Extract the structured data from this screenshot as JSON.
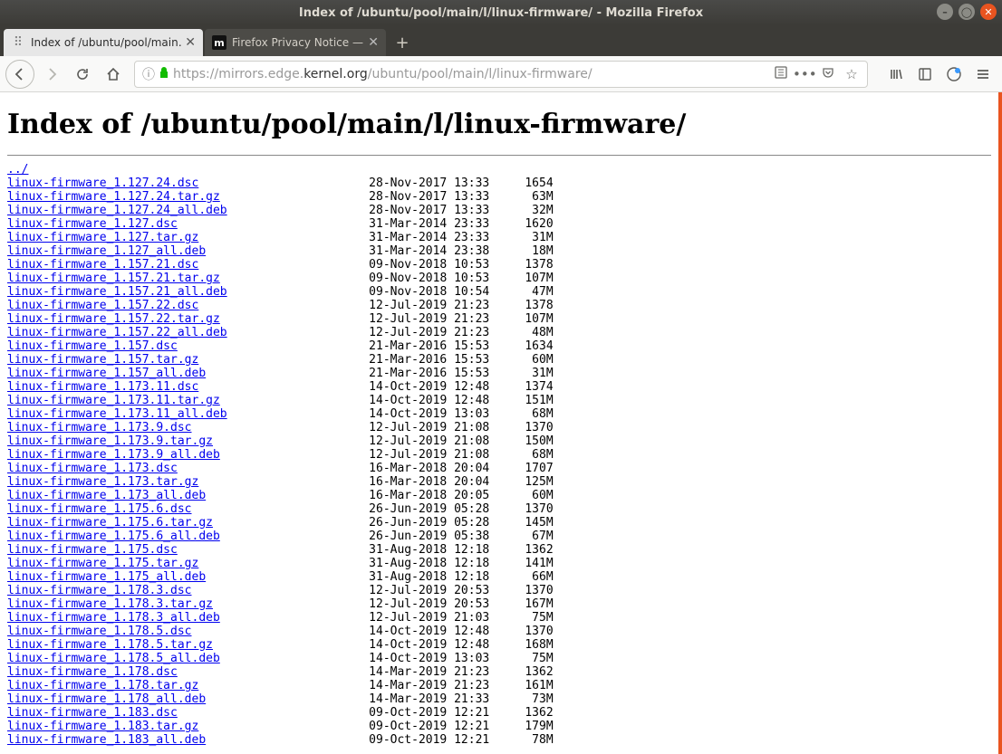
{
  "window": {
    "title": "Index of /ubuntu/pool/main/l/linux-firmware/ - Mozilla Firefox"
  },
  "tabs": [
    {
      "label": "Index of /ubuntu/pool/main…",
      "favicon": "dots",
      "active": true
    },
    {
      "label": "Firefox Privacy Notice —",
      "favicon": "moz",
      "active": false
    }
  ],
  "url": {
    "scheme": "https://",
    "sub": "mirrors.edge.",
    "host": "kernel.org",
    "path": "/ubuntu/pool/main/l/linux-firmware/"
  },
  "page": {
    "heading": "Index of /ubuntu/pool/main/l/linux-firmware/",
    "parent": "../",
    "files": [
      {
        "name": "linux-firmware_1.127.24.dsc",
        "date": "28-Nov-2017 13:33",
        "size": "1654"
      },
      {
        "name": "linux-firmware_1.127.24.tar.gz",
        "date": "28-Nov-2017 13:33",
        "size": "63M"
      },
      {
        "name": "linux-firmware_1.127.24_all.deb",
        "date": "28-Nov-2017 13:33",
        "size": "32M"
      },
      {
        "name": "linux-firmware_1.127.dsc",
        "date": "31-Mar-2014 23:33",
        "size": "1620"
      },
      {
        "name": "linux-firmware_1.127.tar.gz",
        "date": "31-Mar-2014 23:33",
        "size": "31M"
      },
      {
        "name": "linux-firmware_1.127_all.deb",
        "date": "31-Mar-2014 23:38",
        "size": "18M"
      },
      {
        "name": "linux-firmware_1.157.21.dsc",
        "date": "09-Nov-2018 10:53",
        "size": "1378"
      },
      {
        "name": "linux-firmware_1.157.21.tar.gz",
        "date": "09-Nov-2018 10:53",
        "size": "107M"
      },
      {
        "name": "linux-firmware_1.157.21_all.deb",
        "date": "09-Nov-2018 10:54",
        "size": "47M"
      },
      {
        "name": "linux-firmware_1.157.22.dsc",
        "date": "12-Jul-2019 21:23",
        "size": "1378"
      },
      {
        "name": "linux-firmware_1.157.22.tar.gz",
        "date": "12-Jul-2019 21:23",
        "size": "107M"
      },
      {
        "name": "linux-firmware_1.157.22_all.deb",
        "date": "12-Jul-2019 21:23",
        "size": "48M"
      },
      {
        "name": "linux-firmware_1.157.dsc",
        "date": "21-Mar-2016 15:53",
        "size": "1634"
      },
      {
        "name": "linux-firmware_1.157.tar.gz",
        "date": "21-Mar-2016 15:53",
        "size": "60M"
      },
      {
        "name": "linux-firmware_1.157_all.deb",
        "date": "21-Mar-2016 15:53",
        "size": "31M"
      },
      {
        "name": "linux-firmware_1.173.11.dsc",
        "date": "14-Oct-2019 12:48",
        "size": "1374"
      },
      {
        "name": "linux-firmware_1.173.11.tar.gz",
        "date": "14-Oct-2019 12:48",
        "size": "151M"
      },
      {
        "name": "linux-firmware_1.173.11_all.deb",
        "date": "14-Oct-2019 13:03",
        "size": "68M"
      },
      {
        "name": "linux-firmware_1.173.9.dsc",
        "date": "12-Jul-2019 21:08",
        "size": "1370"
      },
      {
        "name": "linux-firmware_1.173.9.tar.gz",
        "date": "12-Jul-2019 21:08",
        "size": "150M"
      },
      {
        "name": "linux-firmware_1.173.9_all.deb",
        "date": "12-Jul-2019 21:08",
        "size": "68M"
      },
      {
        "name": "linux-firmware_1.173.dsc",
        "date": "16-Mar-2018 20:04",
        "size": "1707"
      },
      {
        "name": "linux-firmware_1.173.tar.gz",
        "date": "16-Mar-2018 20:04",
        "size": "125M"
      },
      {
        "name": "linux-firmware_1.173_all.deb",
        "date": "16-Mar-2018 20:05",
        "size": "60M"
      },
      {
        "name": "linux-firmware_1.175.6.dsc",
        "date": "26-Jun-2019 05:28",
        "size": "1370"
      },
      {
        "name": "linux-firmware_1.175.6.tar.gz",
        "date": "26-Jun-2019 05:28",
        "size": "145M"
      },
      {
        "name": "linux-firmware_1.175.6_all.deb",
        "date": "26-Jun-2019 05:38",
        "size": "67M"
      },
      {
        "name": "linux-firmware_1.175.dsc",
        "date": "31-Aug-2018 12:18",
        "size": "1362"
      },
      {
        "name": "linux-firmware_1.175.tar.gz",
        "date": "31-Aug-2018 12:18",
        "size": "141M"
      },
      {
        "name": "linux-firmware_1.175_all.deb",
        "date": "31-Aug-2018 12:18",
        "size": "66M"
      },
      {
        "name": "linux-firmware_1.178.3.dsc",
        "date": "12-Jul-2019 20:53",
        "size": "1370"
      },
      {
        "name": "linux-firmware_1.178.3.tar.gz",
        "date": "12-Jul-2019 20:53",
        "size": "167M"
      },
      {
        "name": "linux-firmware_1.178.3_all.deb",
        "date": "12-Jul-2019 21:03",
        "size": "75M"
      },
      {
        "name": "linux-firmware_1.178.5.dsc",
        "date": "14-Oct-2019 12:48",
        "size": "1370"
      },
      {
        "name": "linux-firmware_1.178.5.tar.gz",
        "date": "14-Oct-2019 12:48",
        "size": "168M"
      },
      {
        "name": "linux-firmware_1.178.5_all.deb",
        "date": "14-Oct-2019 13:03",
        "size": "75M"
      },
      {
        "name": "linux-firmware_1.178.dsc",
        "date": "14-Mar-2019 21:23",
        "size": "1362"
      },
      {
        "name": "linux-firmware_1.178.tar.gz",
        "date": "14-Mar-2019 21:23",
        "size": "161M"
      },
      {
        "name": "linux-firmware_1.178_all.deb",
        "date": "14-Mar-2019 21:33",
        "size": "73M"
      },
      {
        "name": "linux-firmware_1.183.dsc",
        "date": "09-Oct-2019 12:21",
        "size": "1362"
      },
      {
        "name": "linux-firmware_1.183.tar.gz",
        "date": "09-Oct-2019 12:21",
        "size": "179M"
      },
      {
        "name": "linux-firmware_1.183_all.deb",
        "date": "09-Oct-2019 12:21",
        "size": "78M"
      }
    ]
  }
}
